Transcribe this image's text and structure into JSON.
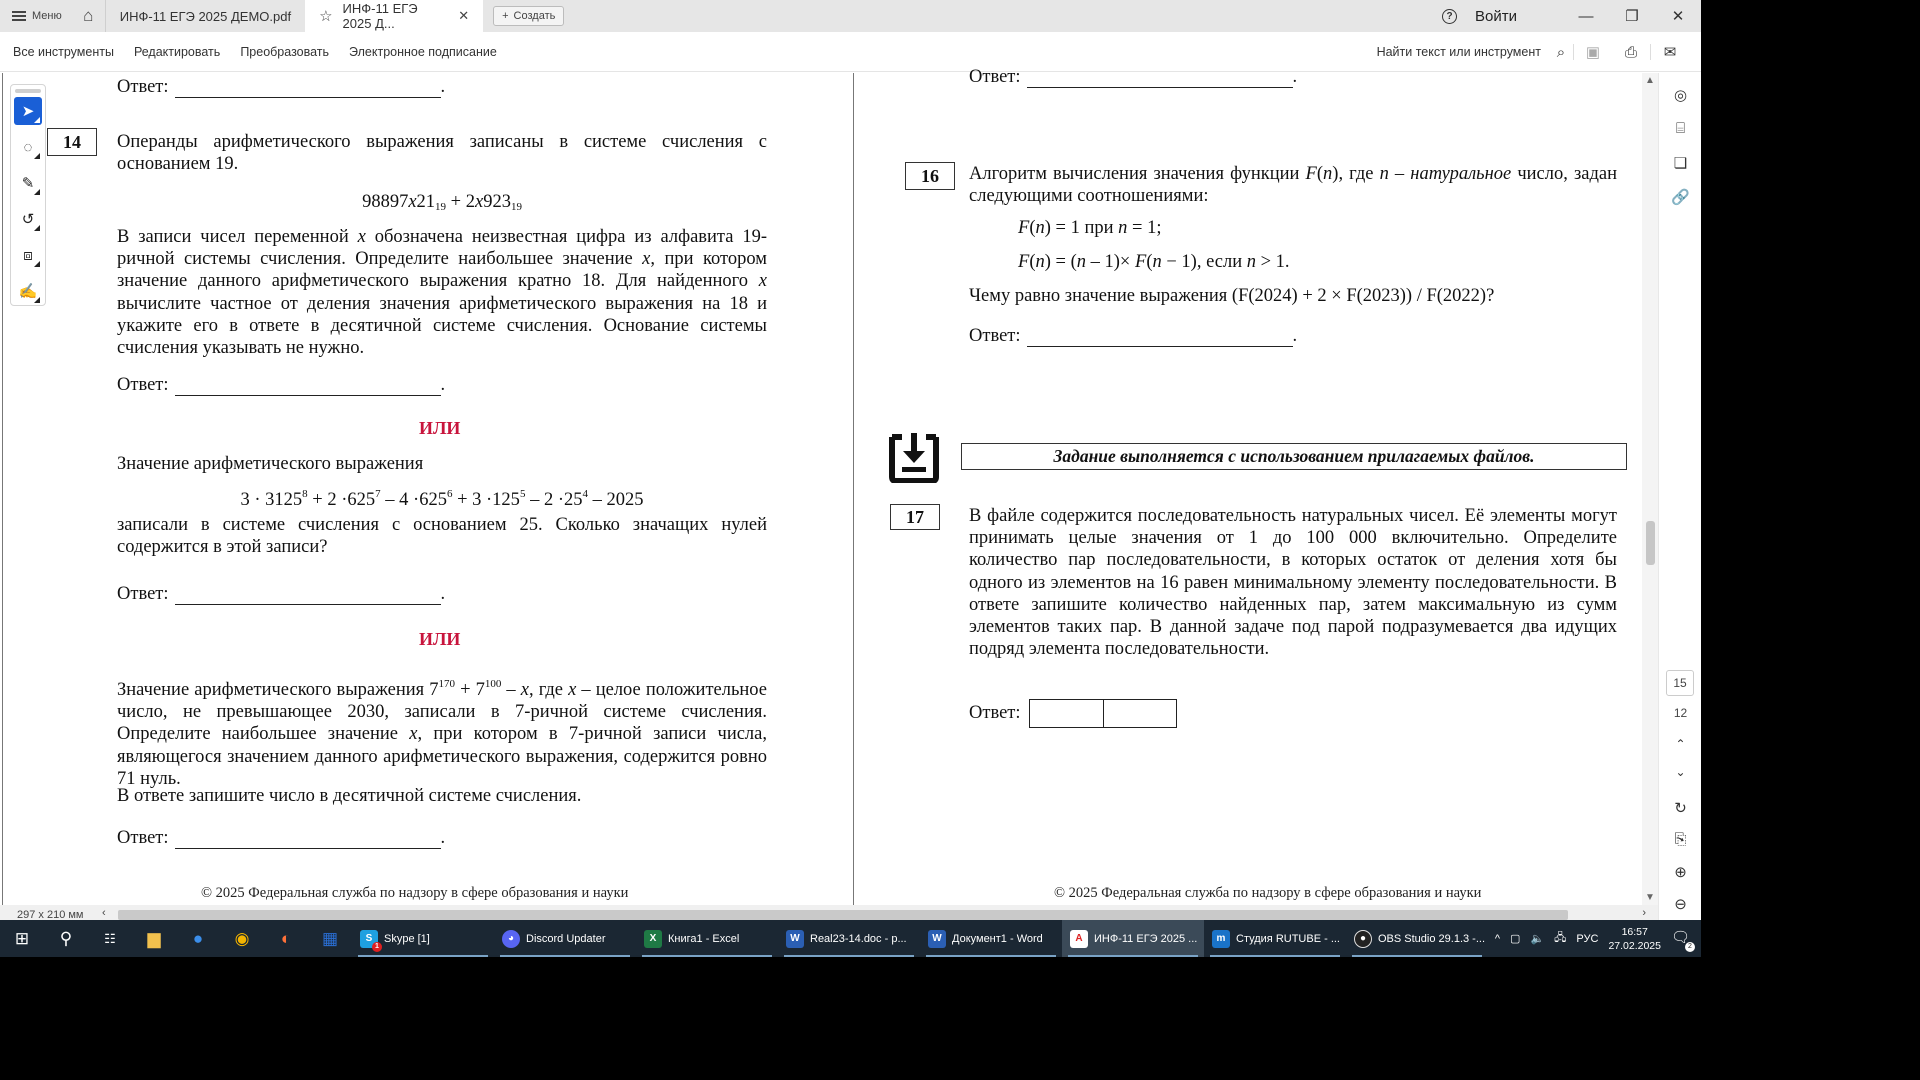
{
  "titlebar": {
    "menu_label": "Меню",
    "tabs": [
      {
        "label": "ИНФ-11 ЕГЭ 2025 ДЕМО.pdf",
        "active": false
      },
      {
        "label": "ИНФ-11 ЕГЭ 2025 Д...",
        "active": true
      }
    ],
    "create_label": "Создать",
    "login_label": "Войти",
    "window_controls": [
      "minimize-icon",
      "restore-icon",
      "close-icon"
    ]
  },
  "toolbar": {
    "links": [
      "Все инструменты",
      "Редактировать",
      "Преобразовать",
      "Электронное подписание"
    ],
    "search_placeholder": "Найти текст или инструмент",
    "icons": [
      "search-icon",
      "save-icon",
      "print-icon",
      "email-icon"
    ]
  },
  "left_tools": [
    "select-cursor-icon",
    "comment-icon",
    "highlight-pen-icon",
    "lasso-draw-icon",
    "text-select-icon",
    "signature-icon"
  ],
  "left_page": {
    "top_answer_label": "Ответ:",
    "task_number": "14",
    "task14_p1": "Операнды арифметического выражения записаны в системе счисления с основанием 19.",
    "task14_formula": {
      "a": "98897",
      "x1": "x",
      "b": "21",
      "base1": "19",
      "plus": " + 2",
      "x2": "x",
      "c": "923",
      "base2": "19"
    },
    "task14_p2_parts": [
      "В записи чисел переменной ",
      "x",
      " обозначена неизвестная цифра из алфавита 19-ричной системы счисления. Определите наибольшее значение ",
      "x",
      ", при котором значение данного арифметического выражения кратно 18. Для найденного ",
      "x",
      " вычислите частное от деления значения арифметического выражения на 18 и укажите его в ответе в десятичной системе счисления. Основание системы счисления указывать не нужно."
    ],
    "answer_label": "Ответ:",
    "or_label": "ИЛИ",
    "variant2_intro": "Значение арифметического выражения",
    "variant2_formula": [
      {
        "base": "3 · 3125",
        "exp": "8"
      },
      {
        "base": " + 2 ·625",
        "exp": "7"
      },
      {
        "base": " – 4 ·625",
        "exp": "6"
      },
      {
        "base": " + 3 ·125",
        "exp": "5"
      },
      {
        "base": " – 2 ·25",
        "exp": "4"
      },
      {
        "base": " – 2025",
        "exp": ""
      }
    ],
    "variant2_question": "записали в системе счисления с основанием 25. Сколько значащих нулей содержится в этой записи?",
    "variant3_p1_parts": [
      "Значение арифметического выражения 7",
      "170",
      " + 7",
      "100",
      " – ",
      "x",
      ", где ",
      "x",
      " – целое положительное число, не превышающее 2030, записали в 7-ричной системе счисления. Определите наибольшее значение ",
      "x",
      ", при котором в 7-ричной записи числа, являющегося значением данного арифметического выражения, содержится ровно 71 нуль."
    ],
    "variant3_p2": "В ответе запишите число в десятичной системе счисления.",
    "footer": "© 2025 Федеральная служба по надзору в сфере образования и науки"
  },
  "right_page": {
    "top_answer_label": "Ответ:",
    "task16_number": "16",
    "task16_p1_parts": [
      "Алгоритм вычисления значения функции ",
      "F",
      "(",
      "n",
      "), где ",
      "n",
      " – натуральное",
      " число, задан следующими соотношениями:"
    ],
    "task16_rule1": {
      "f": "F",
      "n": "n",
      "rest": " = 1 при ",
      "n2": "n",
      "tail": " = 1;"
    },
    "task16_rule2": {
      "f": "F",
      "n": "n",
      "rest": " = (",
      "n2": "n",
      "mid": " – 1)× ",
      "f2": "F",
      "n3": "n",
      "tail": " − 1), если ",
      "n4": "n",
      "end": " > 1."
    },
    "task16_question": "Чему равно значение выражения (F(2024) + 2 × F(2023)) / F(2022)?",
    "answer_label": "Ответ:",
    "file_banner": "Задание выполняется с использованием прилагаемых файлов.",
    "task17_number": "17",
    "task17_text": "В файле содержится последовательность натуральных чисел. Её элементы могут принимать целые значения от 1 до 100 000 включительно. Определите количество пар последовательности, в которых остаток от деления хотя бы одного из элементов на 16 равен минимальному элементу последовательности. В ответе запишите количество найденных пар, затем максимальную из сумм элементов таких пар. В данной задаче под парой подразумевается два идущих подряд элемента последовательности.",
    "task17_answer_label": "Ответ:",
    "footer": "© 2025 Федеральная служба по надзору в сфере образования и науки"
  },
  "side_panel": {
    "icons": [
      "comments-icon",
      "bookmarks-icon",
      "pages-icon",
      "attachments-icon"
    ],
    "current_page": "15",
    "total_pages": "12",
    "nav_icons": [
      "page-up-icon",
      "page-down-icon",
      "rotate-icon",
      "fit-page-icon",
      "zoom-in-icon",
      "zoom-out-icon"
    ]
  },
  "status": {
    "page_size": "297 x 210 мм"
  },
  "taskbar": {
    "apps": [
      {
        "label": "Skype [1]",
        "icon": "skype-icon",
        "color": "#1ea0e0",
        "badge": "1"
      },
      {
        "label": "Discord Updater",
        "icon": "discord-icon",
        "color": "#5865f2"
      },
      {
        "label": "Книга1 - Excel",
        "icon": "excel-icon",
        "color": "#1f7a45"
      },
      {
        "label": "Real23-14.doc - p...",
        "icon": "word-icon",
        "color": "#2b5fb4"
      },
      {
        "label": "Документ1 - Word",
        "icon": "word-icon",
        "color": "#2b5fb4"
      },
      {
        "label": "ИНФ-11 ЕГЭ 2025 ...",
        "icon": "pdf-icon",
        "color": "#d22",
        "active": true
      },
      {
        "label": "Студия RUTUBE - ...",
        "icon": "rutube-icon",
        "color": "#1a73c8"
      },
      {
        "label": "OBS Studio 29.1.3 -...",
        "icon": "obs-icon",
        "color": "#222"
      }
    ],
    "language": "РУС",
    "time": "16:57",
    "date": "27.02.2025",
    "notifications": "2"
  }
}
